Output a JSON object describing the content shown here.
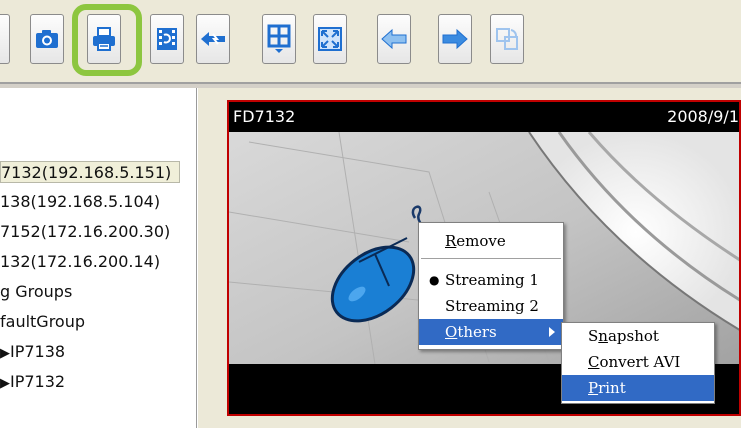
{
  "toolbar": {
    "buttons": [
      {
        "name": "camera-snapshot"
      },
      {
        "name": "print"
      },
      {
        "name": "record"
      },
      {
        "name": "stream"
      },
      {
        "name": "layout-grid"
      },
      {
        "name": "fullscreen"
      },
      {
        "name": "previous"
      },
      {
        "name": "next"
      },
      {
        "name": "cycle"
      }
    ],
    "highlighted": "print",
    "highlight_color": "#8dc63f"
  },
  "tree": {
    "items": [
      "7132(192.168.5.151)",
      "138(192.168.5.104)",
      "7152(172.16.200.30)",
      "132(172.16.200.14)",
      "g Groups",
      "faultGroup",
      "IP7138",
      "IP7132"
    ],
    "selected_index": 0
  },
  "video": {
    "camera_name": "FD7132",
    "date_text": "2008/9/1",
    "border_color": "#c00000"
  },
  "context_menu": {
    "remove_prefix": "",
    "remove_u": "R",
    "remove_rest": "emove",
    "streaming1": "Streaming 1",
    "streaming2": "Streaming 2",
    "others_u": "O",
    "others_rest": "thers",
    "checked": "streaming1"
  },
  "submenu": {
    "snapshot_a": "S",
    "snapshot_u": "n",
    "snapshot_rest": "apshot",
    "convert_u": "C",
    "convert_rest": "onvert AVI",
    "print_u": "P",
    "print_rest": "rint",
    "highlighted": "print",
    "highlight_color": "#316ac5"
  }
}
